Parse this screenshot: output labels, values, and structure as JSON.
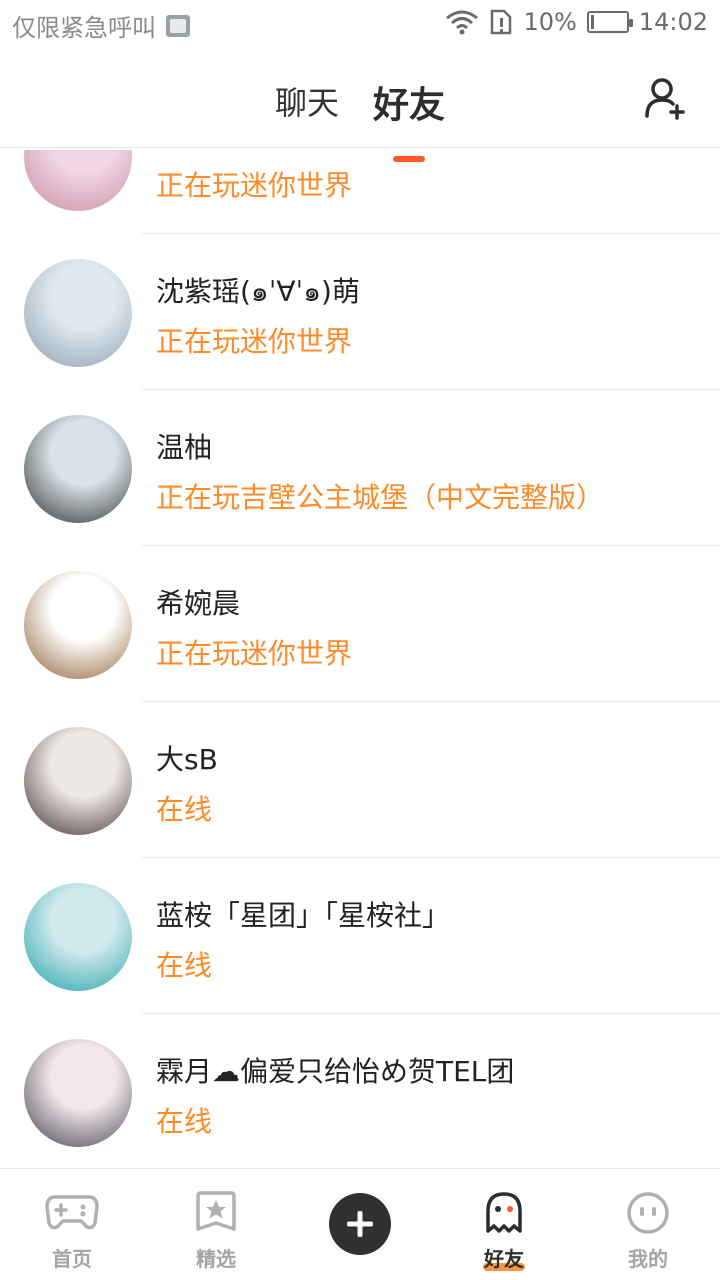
{
  "status_bar": {
    "left_text": "仅限紧急呼叫",
    "battery_text": "10%",
    "battery_level": 0.1,
    "time": "14:02"
  },
  "header": {
    "tabs": [
      {
        "label": "聊天",
        "active": false
      },
      {
        "label": "好友",
        "active": true
      }
    ],
    "add_friend_icon": "add-user-icon"
  },
  "friends": [
    {
      "name": "",
      "status": "正在玩迷你世界",
      "avatar_colors": [
        "#f1d6e4",
        "#c78ca0"
      ]
    },
    {
      "name": "沈紫瑶(๑ˈ∀ˈ๑)萌",
      "status": "正在玩迷你世界",
      "avatar_colors": [
        "#dfe9ee",
        "#8a9bb1"
      ]
    },
    {
      "name": "温柚",
      "status": "正在玩吉壁公主城堡（中文完整版）",
      "avatar_colors": [
        "#d8e2e8",
        "#2a2a2a"
      ]
    },
    {
      "name": "希婉晨",
      "status": "正在玩迷你世界",
      "avatar_colors": [
        "#ffffff",
        "#8b5a2b"
      ]
    },
    {
      "name": "大sB",
      "status": "在线",
      "avatar_colors": [
        "#efe9e6",
        "#3b2a2a"
      ]
    },
    {
      "name": "蓝桉「星团」「星桉社」",
      "status": "在线",
      "avatar_colors": [
        "#cfe9ec",
        "#1aa0a8"
      ]
    },
    {
      "name": "霖月☁偏爱只给怡め贺TEL团",
      "status": "在线",
      "avatar_colors": [
        "#f3e7ea",
        "#3b3b4a"
      ]
    }
  ],
  "bottom_nav": {
    "items": [
      {
        "label": "首页",
        "icon": "gamepad-icon",
        "active": false
      },
      {
        "label": "精选",
        "icon": "star-icon",
        "active": false
      },
      {
        "label": "",
        "icon": "plus-icon",
        "active": false
      },
      {
        "label": "好友",
        "icon": "ghost-icon",
        "active": true
      },
      {
        "label": "我的",
        "icon": "face-icon",
        "active": false
      }
    ]
  },
  "colors": {
    "accent_orange": "#ff8a28",
    "tab_underline": "#ff5a1f",
    "text_dark": "#222222",
    "muted": "#a4a4a4"
  }
}
